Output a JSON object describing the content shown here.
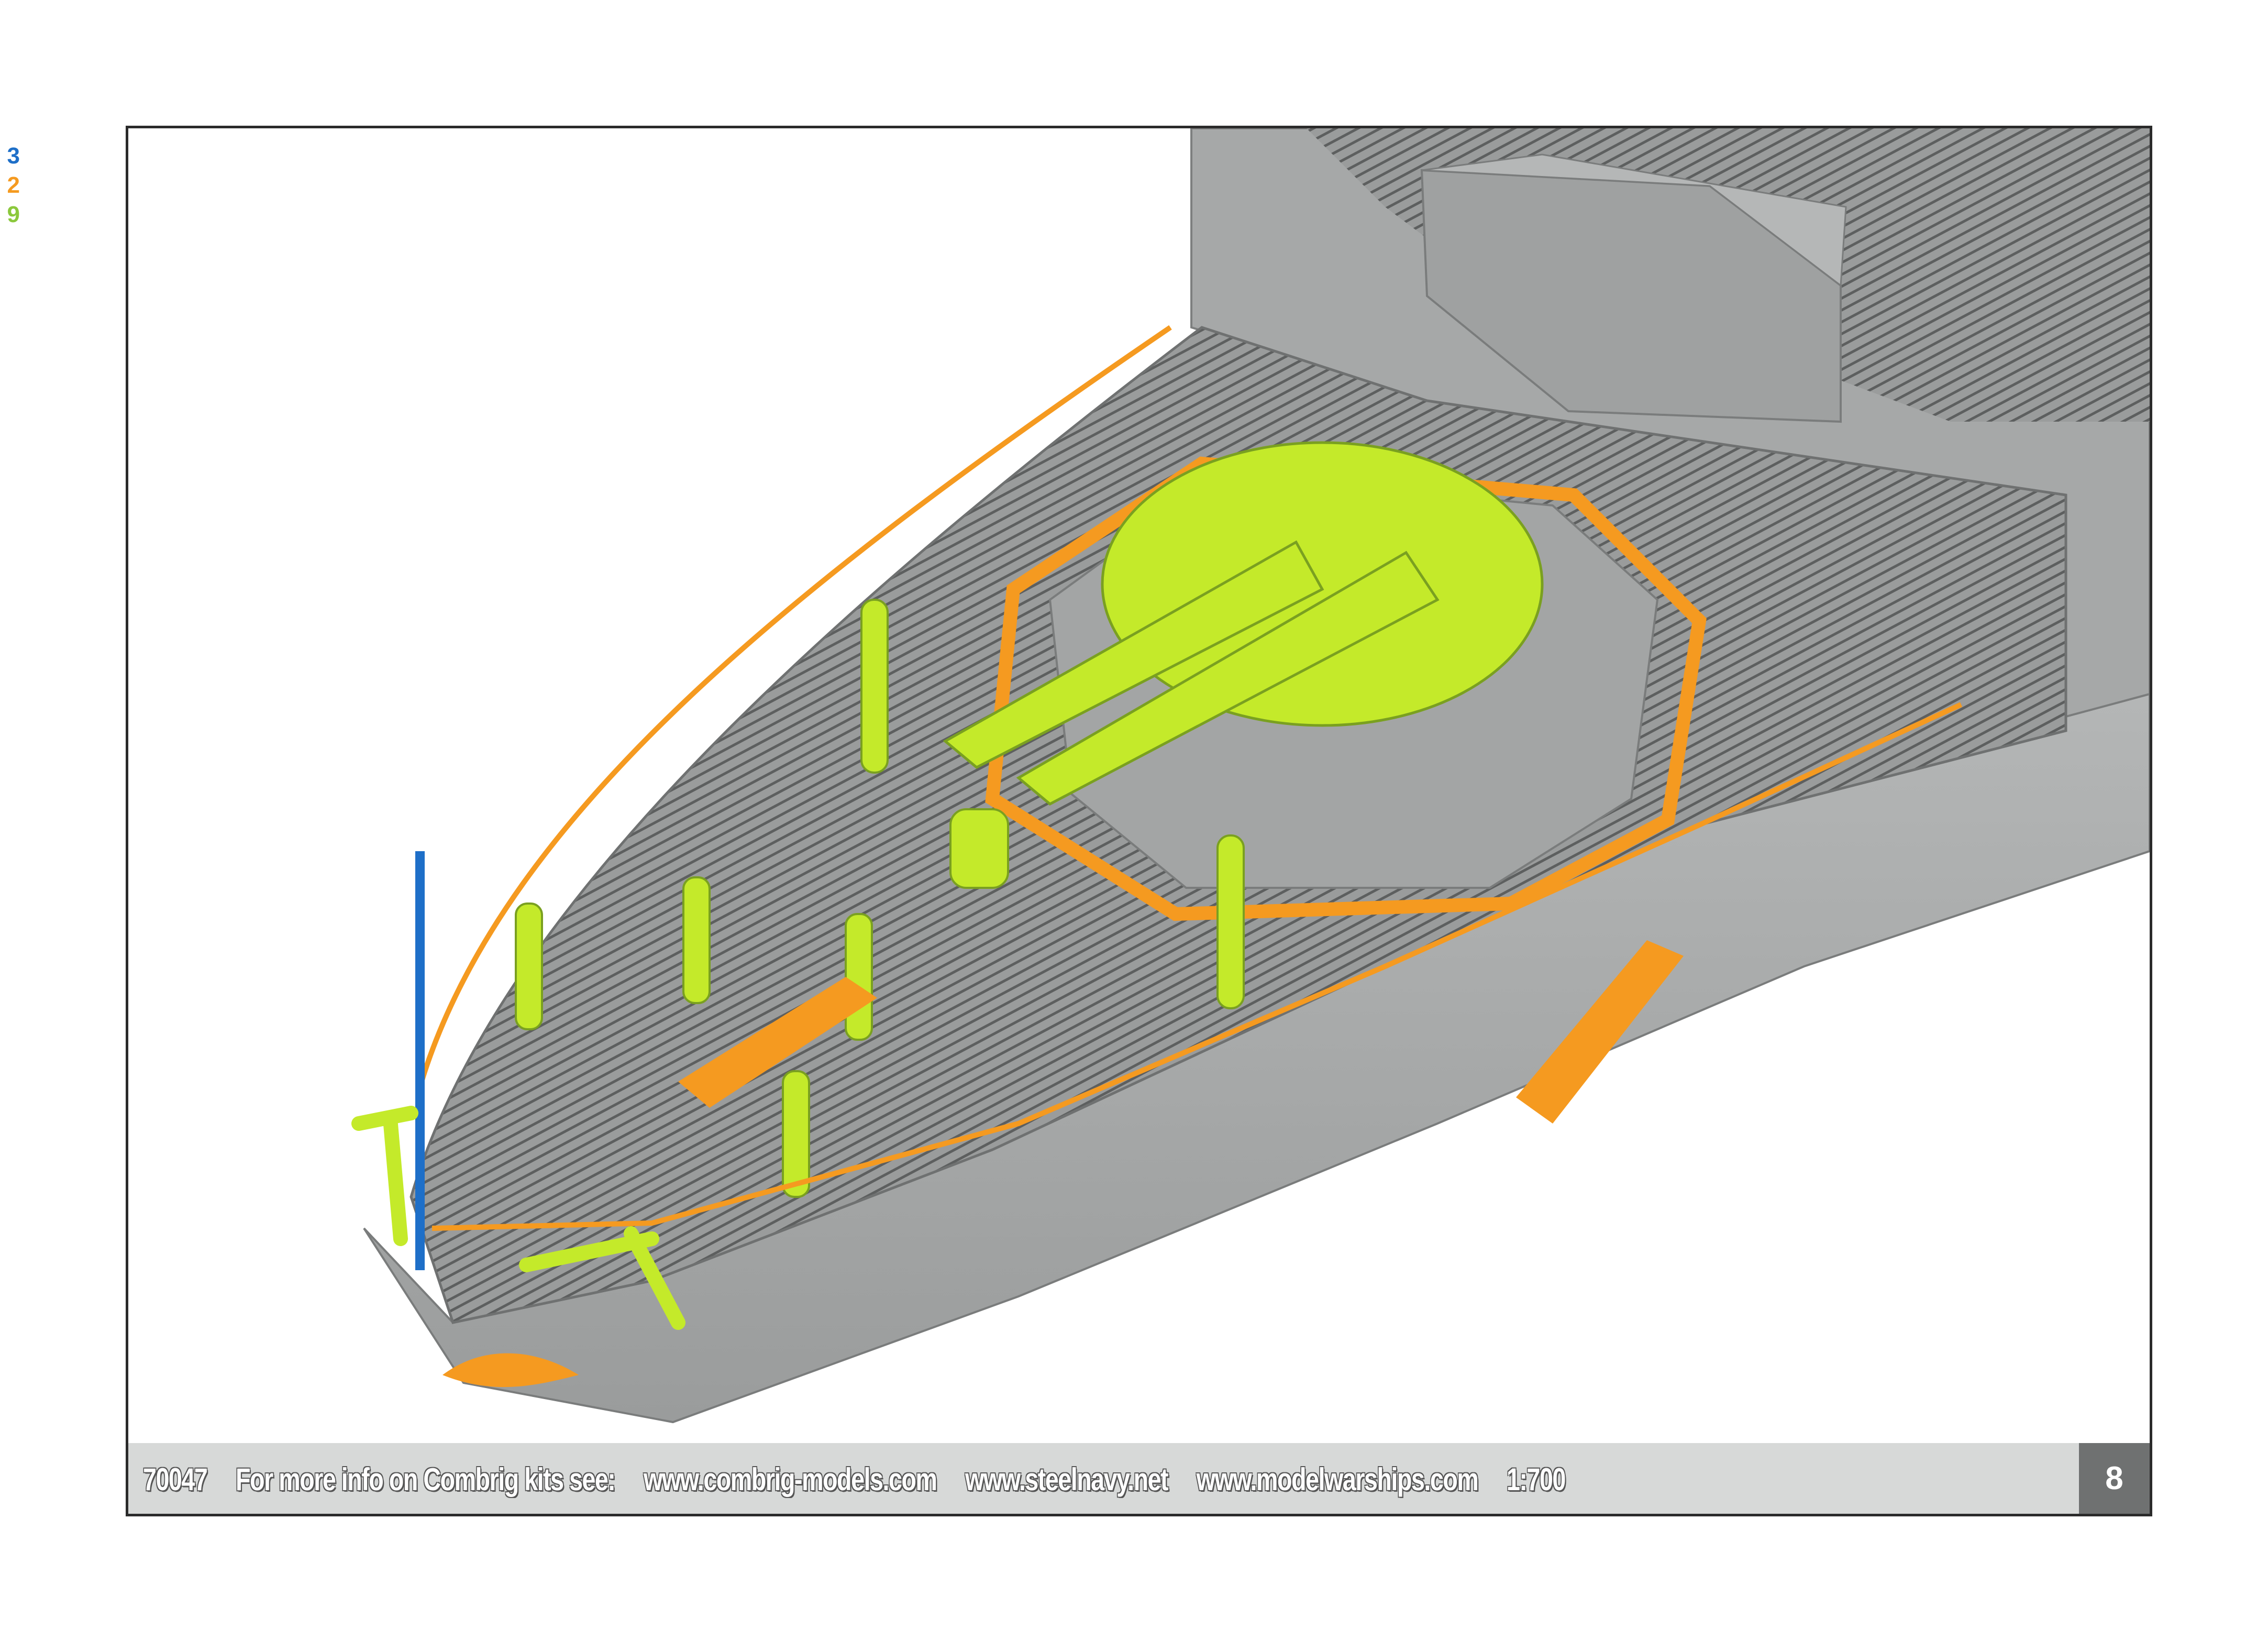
{
  "legend": {
    "items": [
      {
        "label": "3",
        "color": "#1e6fc8"
      },
      {
        "label": "2",
        "color": "#f59a20"
      },
      {
        "label": "9",
        "color": "#8bc83c"
      }
    ]
  },
  "colors": {
    "hull": "#a9abab",
    "hull_dark": "#8c8e8e",
    "deck": "#9a9c9c",
    "photoetch_orange": "#f59a20",
    "resin_green": "#c4ea2a",
    "wire_blue": "#1e6fc8",
    "footer_bg": "#d7d9d8",
    "page_badge": "#6f7171"
  },
  "footer": {
    "kit_number": "70047",
    "info_label": "For more info on Combrig kits see:",
    "link_1": "www.combrig-models.com",
    "link_2": "www.steelnavy.net",
    "link_3": "www.modelwarships.com",
    "scale": "1:700",
    "page_number": "8"
  }
}
